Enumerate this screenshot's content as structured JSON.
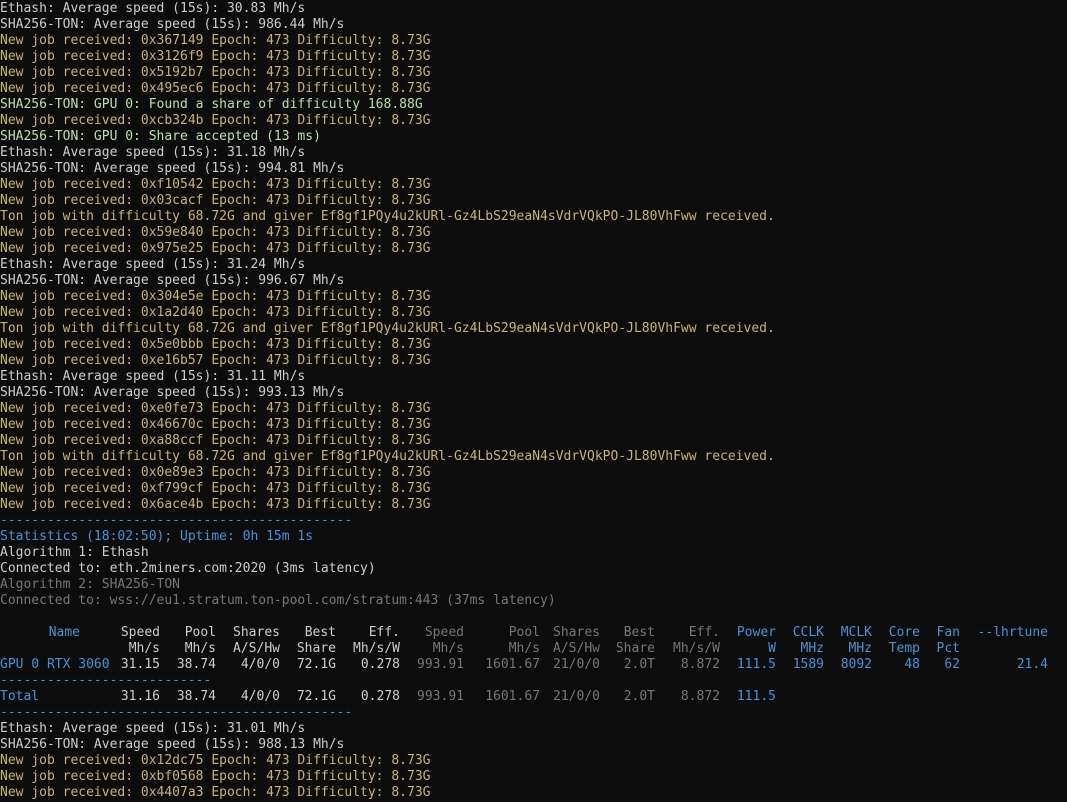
{
  "log_top": [
    {
      "text": "Ethash: Average speed (15s): 30.83 Mh/s",
      "color": "white"
    },
    {
      "text": "SHA256-TON: Average speed (15s): 986.44 Mh/s",
      "color": "white"
    },
    {
      "text": "New job received: 0x367149 Epoch: 473 Difficulty: 8.73G",
      "color": "yellow"
    },
    {
      "text": "New job received: 0x3126f9 Epoch: 473 Difficulty: 8.73G",
      "color": "yellow"
    },
    {
      "text": "New job received: 0x5192b7 Epoch: 473 Difficulty: 8.73G",
      "color": "yellow"
    },
    {
      "text": "New job received: 0x495ec6 Epoch: 473 Difficulty: 8.73G",
      "color": "yellow"
    },
    {
      "text": "SHA256-TON: GPU 0: Found a share of difficulty 168.88G",
      "color": "green"
    },
    {
      "text": "New job received: 0xcb324b Epoch: 473 Difficulty: 8.73G",
      "color": "yellow"
    },
    {
      "text": "SHA256-TON: GPU 0: Share accepted (13 ms)",
      "color": "green"
    },
    {
      "text": "Ethash: Average speed (15s): 31.18 Mh/s",
      "color": "white"
    },
    {
      "text": "SHA256-TON: Average speed (15s): 994.81 Mh/s",
      "color": "white"
    },
    {
      "text": "New job received: 0xf10542 Epoch: 473 Difficulty: 8.73G",
      "color": "yellow"
    },
    {
      "text": "New job received: 0x03cacf Epoch: 473 Difficulty: 8.73G",
      "color": "yellow"
    },
    {
      "text": "Ton job with difficulty 68.72G and giver Ef8gf1PQy4u2kURl-Gz4LbS29eaN4sVdrVQkPO-JL80VhFww received.",
      "color": "yellow"
    },
    {
      "text": "New job received: 0x59e840 Epoch: 473 Difficulty: 8.73G",
      "color": "yellow"
    },
    {
      "text": "New job received: 0x975e25 Epoch: 473 Difficulty: 8.73G",
      "color": "yellow"
    },
    {
      "text": "Ethash: Average speed (15s): 31.24 Mh/s",
      "color": "white"
    },
    {
      "text": "SHA256-TON: Average speed (15s): 996.67 Mh/s",
      "color": "white"
    },
    {
      "text": "New job received: 0x304e5e Epoch: 473 Difficulty: 8.73G",
      "color": "yellow"
    },
    {
      "text": "New job received: 0x1a2d40 Epoch: 473 Difficulty: 8.73G",
      "color": "yellow"
    },
    {
      "text": "Ton job with difficulty 68.72G and giver Ef8gf1PQy4u2kURl-Gz4LbS29eaN4sVdrVQkPO-JL80VhFww received.",
      "color": "yellow"
    },
    {
      "text": "New job received: 0x5e0bbb Epoch: 473 Difficulty: 8.73G",
      "color": "yellow"
    },
    {
      "text": "New job received: 0xe16b57 Epoch: 473 Difficulty: 8.73G",
      "color": "yellow"
    },
    {
      "text": "Ethash: Average speed (15s): 31.11 Mh/s",
      "color": "white"
    },
    {
      "text": "SHA256-TON: Average speed (15s): 993.13 Mh/s",
      "color": "white"
    },
    {
      "text": "New job received: 0xe0fe73 Epoch: 473 Difficulty: 8.73G",
      "color": "yellow"
    },
    {
      "text": "New job received: 0x46670c Epoch: 473 Difficulty: 8.73G",
      "color": "yellow"
    },
    {
      "text": "New job received: 0xa88ccf Epoch: 473 Difficulty: 8.73G",
      "color": "yellow"
    },
    {
      "text": "Ton job with difficulty 68.72G and giver Ef8gf1PQy4u2kURl-Gz4LbS29eaN4sVdrVQkPO-JL80VhFww received.",
      "color": "yellow"
    },
    {
      "text": "New job received: 0x0e89e3 Epoch: 473 Difficulty: 8.73G",
      "color": "yellow"
    },
    {
      "text": "New job received: 0xf799cf Epoch: 473 Difficulty: 8.73G",
      "color": "yellow"
    },
    {
      "text": "New job received: 0x6ace4b Epoch: 473 Difficulty: 8.73G",
      "color": "yellow"
    }
  ],
  "stats": {
    "separator_top": "---------------------------------------------",
    "header": "Statistics (18:02:50); Uptime: 0h 15m 1s",
    "algo1": "Algorithm 1: Ethash",
    "algo1_conn": "Connected to: eth.2miners.com:2020 (3ms latency)",
    "algo2": "Algorithm 2: SHA256-TON",
    "algo2_conn": "Connected to: wss://eu1.stratum.ton-pool.com/stratum:443 (37ms latency)",
    "columns": [
      {
        "h1": "Name",
        "h2": "",
        "color": "blue"
      },
      {
        "h1": "Speed",
        "h2": "Mh/s",
        "color": "white"
      },
      {
        "h1": "Pool",
        "h2": "Mh/s",
        "color": "white"
      },
      {
        "h1": "Shares",
        "h2": "A/S/Hw",
        "color": "white"
      },
      {
        "h1": "Best",
        "h2": "Share",
        "color": "white"
      },
      {
        "h1": "Eff.",
        "h2": "Mh/s/W",
        "color": "white"
      },
      {
        "h1": "Speed",
        "h2": "Mh/s",
        "color": "gray"
      },
      {
        "h1": "Pool",
        "h2": "Mh/s",
        "color": "gray"
      },
      {
        "h1": "Shares",
        "h2": "A/S/Hw",
        "color": "gray"
      },
      {
        "h1": "Best",
        "h2": "Share",
        "color": "gray"
      },
      {
        "h1": "Eff.",
        "h2": "Mh/s/W",
        "color": "gray"
      },
      {
        "h1": "Power",
        "h2": "W",
        "color": "blue"
      },
      {
        "h1": "CCLK",
        "h2": "MHz",
        "color": "blue"
      },
      {
        "h1": "MCLK",
        "h2": "MHz",
        "color": "blue"
      },
      {
        "h1": "Core",
        "h2": "Temp",
        "color": "blue"
      },
      {
        "h1": "Fan",
        "h2": "Pct",
        "color": "blue"
      },
      {
        "h1": "--lhrtune",
        "h2": "",
        "color": "blue"
      }
    ],
    "gpu_row": [
      "GPU 0 RTX 3060",
      "31.15",
      "38.74",
      "4/0/0",
      "72.1G",
      "0.278",
      "993.91",
      "1601.67",
      "21/0/0",
      "2.0T",
      "8.872",
      "111.5",
      "1589",
      "8092",
      "48",
      "62",
      "21.4"
    ],
    "row_separator": "---------------------------",
    "total_row": [
      "Total",
      "31.16",
      "38.74",
      "4/0/0",
      "72.1G",
      "0.278",
      "993.91",
      "1601.67",
      "21/0/0",
      "2.0T",
      "8.872",
      "111.5",
      "",
      "",
      "",
      "",
      ""
    ],
    "separator_bottom": "---------------------------------------------"
  },
  "log_bottom": [
    {
      "text": "Ethash: Average speed (15s): 31.01 Mh/s",
      "color": "white"
    },
    {
      "text": "SHA256-TON: Average speed (15s): 988.13 Mh/s",
      "color": "white"
    },
    {
      "text": "New job received: 0x12dc75 Epoch: 473 Difficulty: 8.73G",
      "color": "yellow"
    },
    {
      "text": "New job received: 0xbf0568 Epoch: 473 Difficulty: 8.73G",
      "color": "yellow"
    },
    {
      "text": "New job received: 0x4407a3 Epoch: 473 Difficulty: 8.73G",
      "color": "yellow"
    }
  ]
}
